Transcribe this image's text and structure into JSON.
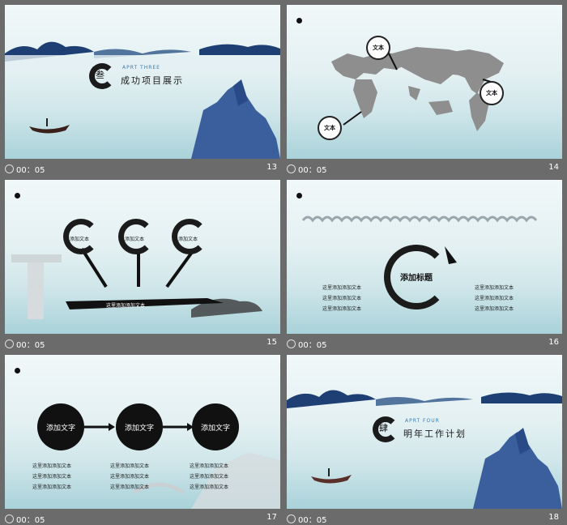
{
  "slides": [
    {
      "time": "00：05",
      "number": "13",
      "heading_en": "APRT THREE",
      "heading_cn": "成功项目展示",
      "badge": "叁"
    },
    {
      "time": "00：05",
      "number": "14",
      "bubbles": [
        "文本",
        "文本",
        "文本"
      ]
    },
    {
      "time": "00：05",
      "number": "15",
      "circle_labels": [
        "添加文本",
        "添加文本",
        "添加文本"
      ],
      "bar_text": "这里添加添加文本"
    },
    {
      "time": "00：05",
      "number": "16",
      "center_title": "添加标题",
      "left_lines": [
        "这里添加添加文本",
        "这里添加添加文本",
        "这里添加添加文本"
      ],
      "right_lines": [
        "这里添加添加文本",
        "这里添加添加文本",
        "这里添加添加文本"
      ]
    },
    {
      "time": "00：05",
      "number": "17",
      "circles": [
        "添加文字",
        "添加文字",
        "添加文字"
      ],
      "col1": [
        "这里添加添加文本",
        "这里添加添加文本",
        "这里添加添加文本"
      ],
      "col2": [
        "这里添加添加文本",
        "这里添加添加文本",
        "这里添加添加文本"
      ],
      "col3": [
        "这里添加添加文本",
        "这里添加添加文本",
        "这里添加添加文本"
      ]
    },
    {
      "time": "00：05",
      "number": "18",
      "heading_en": "APRT FOUR",
      "heading_cn": "明年工作计划",
      "badge": "肆"
    }
  ]
}
